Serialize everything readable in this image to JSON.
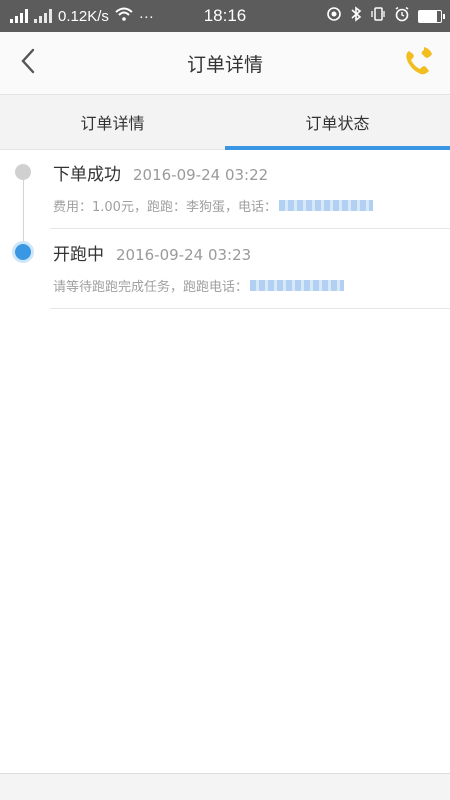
{
  "status_bar": {
    "network_speed": "0.12K/s",
    "more": "···",
    "time": "18:16",
    "icons": [
      "signal-icon",
      "sim2-signal-icon",
      "wifi-icon",
      "location-icon",
      "bluetooth-icon",
      "vibrate-icon",
      "alarm-icon",
      "battery-icon"
    ]
  },
  "header": {
    "title": "订单详情",
    "back_icon": "back-chevron-icon",
    "phone_icon": "phone-icon",
    "accent": "#f2bd1f"
  },
  "tabs": [
    {
      "label": "订单详情",
      "active": false
    },
    {
      "label": "订单状态",
      "active": true
    }
  ],
  "accent_color": "#3a97e4",
  "timeline": [
    {
      "title": "下单成功",
      "time": "2016-09-24 03:22",
      "detail": "费用：1.00元，跑跑：李狗蛋，电话：",
      "state": "done"
    },
    {
      "title": "开跑中",
      "time": "2016-09-24 03:23",
      "detail": "请等待跑跑完成任务，跑跑电话：",
      "state": "current"
    }
  ]
}
